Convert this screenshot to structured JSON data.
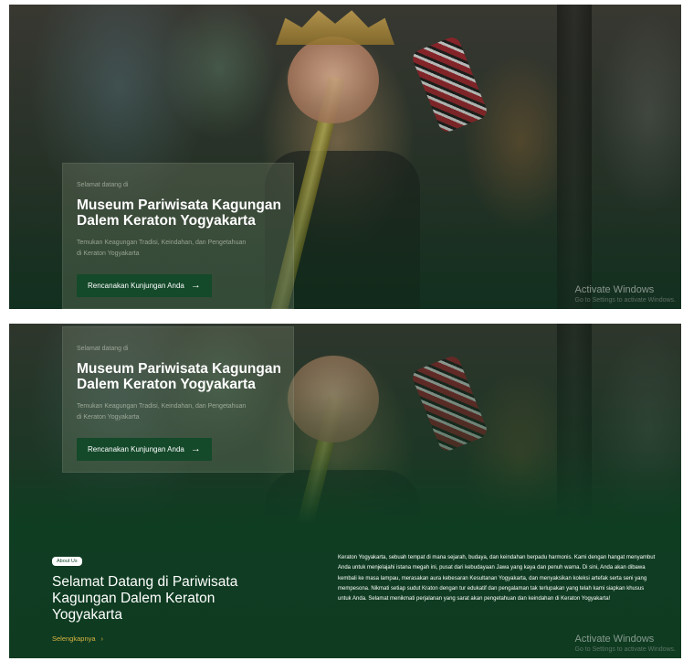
{
  "hero": {
    "eyebrow": "Selamat datang di",
    "title": "Museum Pariwisata Kagungan Dalem Keraton Yogyakarta",
    "subtitle": "Temukan Keagungan Tradisi, Keindahan, dan Pengetahuan di Keraton Yogyakarta",
    "cta_label": "Rencanakan Kunjungan Anda",
    "cta_arrow": "→"
  },
  "watermark": {
    "title": "Activate Windows",
    "subtitle": "Go to Settings to activate Windows."
  },
  "about": {
    "badge": "About Us",
    "title": "Selamat Datang di Pariwisata Kagungan Dalem Keraton Yogyakarta",
    "link_label": "Selengkapnya",
    "link_arrow": "›",
    "body": "Keraton Yogyakarta, sebuah tempat di mana sejarah, budaya, dan keindahan berpadu harmonis. Kami dengan hangat menyambut Anda untuk menjelajahi istana megah ini, pusat dari kebudayaan Jawa yang kaya dan penuh warna. Di sini, Anda akan dibawa kembali ke masa lampau, merasakan aura kebesaran Kesultanan Yogyakarta, dan menyaksikan koleksi artefak serta seni yang mempesona. Nikmati setiap sudut Kraton dengan tur edukatif dan pengalaman tak terlupakan yang telah kami siapkan khusus untuk Anda. Selamat menikmati perjalanan yang sarat akan pengetahuan dan keindahan di Keraton Yogyakarta!"
  },
  "colors": {
    "brand_green": "#14492a",
    "accent_gold": "#d8b440"
  }
}
